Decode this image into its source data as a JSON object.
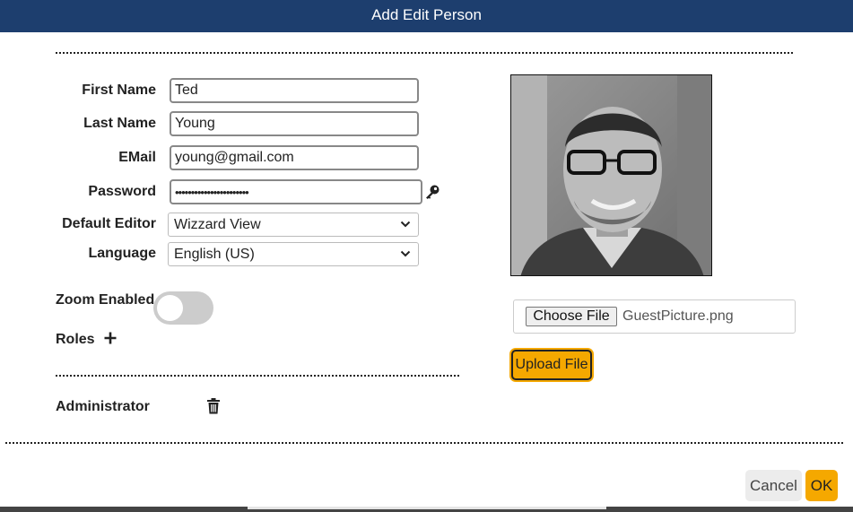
{
  "dialog": {
    "title": "Add Edit Person"
  },
  "form": {
    "first_name_label": "First Name",
    "first_name_value": "Ted",
    "last_name_label": "Last Name",
    "last_name_value": "Young",
    "email_label": "EMail",
    "email_value": "young@gmail.com",
    "password_label": "Password",
    "password_value": "•••••••••••••••••••••••",
    "default_editor_label": "Default Editor",
    "default_editor_value": "Wizzard View",
    "language_label": "Language",
    "language_value": "English (US)",
    "zoom_label": "Zoom Enabled",
    "zoom_enabled": false,
    "roles_label": "Roles"
  },
  "roles": [
    {
      "name": "Administrator"
    }
  ],
  "upload": {
    "choose_label": "Choose File",
    "file_name": "GuestPicture.png",
    "upload_label": "Upload File"
  },
  "footer": {
    "cancel_label": "Cancel",
    "ok_label": "OK"
  },
  "colors": {
    "header_bg": "#1d3e6e",
    "accent": "#f5a800",
    "toggle_off": "#cccccc"
  },
  "icons": {
    "password": "key-icon",
    "roles_add": "plus-icon",
    "role_delete": "trash-icon",
    "select": "chevron-down-icon"
  }
}
